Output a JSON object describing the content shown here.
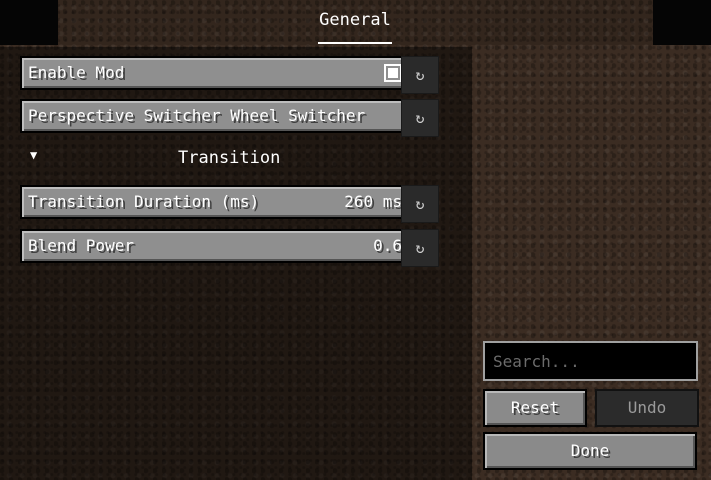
{
  "tabs": [
    {
      "label": "General",
      "active": true
    }
  ],
  "options": [
    {
      "label": "Enable Mod",
      "type": "toggle",
      "checked": true
    },
    {
      "label": "Perspective Switcher Wheel Switcher",
      "type": "cycle"
    },
    {
      "label": "Transition Duration (ms)",
      "type": "slider",
      "value": "260 ms"
    },
    {
      "label": "Blend Power",
      "type": "slider",
      "value": "0.6"
    }
  ],
  "section": {
    "title": "Transition",
    "arrow": "▼"
  },
  "reset_icon": "↻",
  "search": {
    "placeholder": "Search..."
  },
  "actions": {
    "reset": "Reset",
    "undo": "Undo",
    "done": "Done"
  },
  "colors": {
    "button_gray": "#8f8f8f",
    "panel_dark": "#000000",
    "dirt_brown": "#3b2c22"
  },
  "icons": {
    "reset": "reset-icon",
    "section_arrow": "triangle-down-icon",
    "checkbox": "checkbox-checked-icon"
  }
}
